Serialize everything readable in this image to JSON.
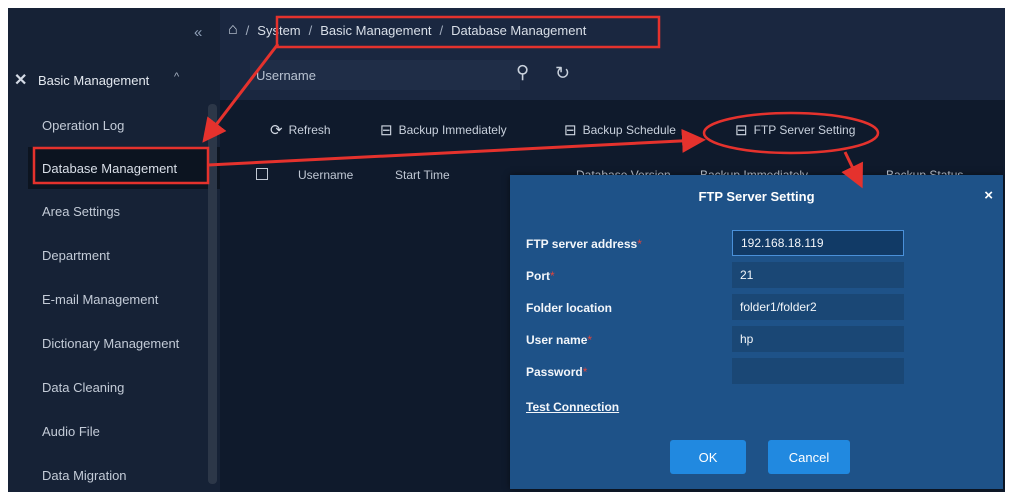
{
  "sidebar": {
    "collapse_icon": "double-chevron-left-icon",
    "group": {
      "label": "Basic Management",
      "icon": "tools-icon"
    },
    "items": [
      {
        "label": "Operation Log"
      },
      {
        "label": "Database Management"
      },
      {
        "label": "Area Settings"
      },
      {
        "label": "Department"
      },
      {
        "label": "E-mail Management"
      },
      {
        "label": "Dictionary Management"
      },
      {
        "label": "Data Cleaning"
      },
      {
        "label": "Audio File"
      },
      {
        "label": "Data Migration"
      }
    ]
  },
  "breadcrumb": {
    "sep": "/",
    "items": [
      "System",
      "Basic Management",
      "Database Management"
    ]
  },
  "search": {
    "placeholder": "Username"
  },
  "toolbar": {
    "refresh": "Refresh",
    "backup_immediately": "Backup Immediately",
    "backup_schedule": "Backup Schedule",
    "ftp_server_setting": "FTP Server Setting"
  },
  "table": {
    "columns": [
      "Username",
      "Start Time",
      "Database Version",
      "Backup Immediately",
      "Backup Status"
    ]
  },
  "dialog": {
    "title": "FTP Server Setting",
    "close": "×",
    "fields": {
      "address": {
        "label": "FTP server address",
        "value": "192.168.18.119"
      },
      "port": {
        "label": "Port",
        "value": "21"
      },
      "folder": {
        "label": "Folder location",
        "value": "folder1/folder2"
      },
      "user": {
        "label": "User name",
        "value": "hp"
      },
      "password": {
        "label": "Password",
        "value": ""
      }
    },
    "required_mark": "*",
    "test_connection": "Test Connection",
    "ok": "OK",
    "cancel": "Cancel"
  },
  "colors": {
    "background": "#0f1a2c",
    "dialog": "#1e5288",
    "primary_button": "#2189e0",
    "annotation": "#e5322d"
  }
}
